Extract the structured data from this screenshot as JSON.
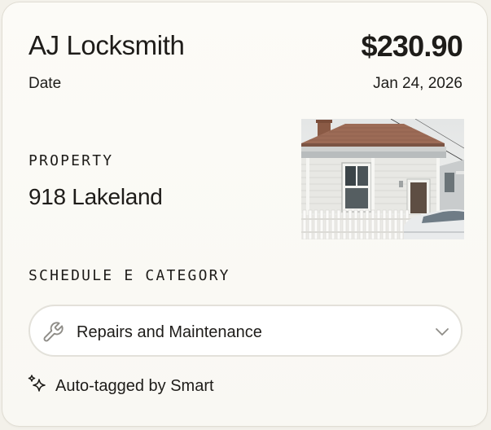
{
  "transaction": {
    "vendor": "AJ Locksmith",
    "amount": "$230.90",
    "date_label": "Date",
    "date_value": "Jan 24, 2026"
  },
  "property": {
    "label": "PROPERTY",
    "name": "918 Lakeland",
    "photo_icon": "house-photo"
  },
  "schedule_e": {
    "label": "SCHEDULE E CATEGORY",
    "selected": "Repairs and Maintenance",
    "select_icon": "wrench-icon",
    "dropdown_icon": "chevron-down-icon"
  },
  "auto_tag": {
    "text": "Auto-tagged by Smart",
    "icon": "sparkle-icon"
  },
  "colors": {
    "card_background": "#fcfbf7",
    "text": "#1e1c19",
    "select_border": "#e3e1da"
  }
}
